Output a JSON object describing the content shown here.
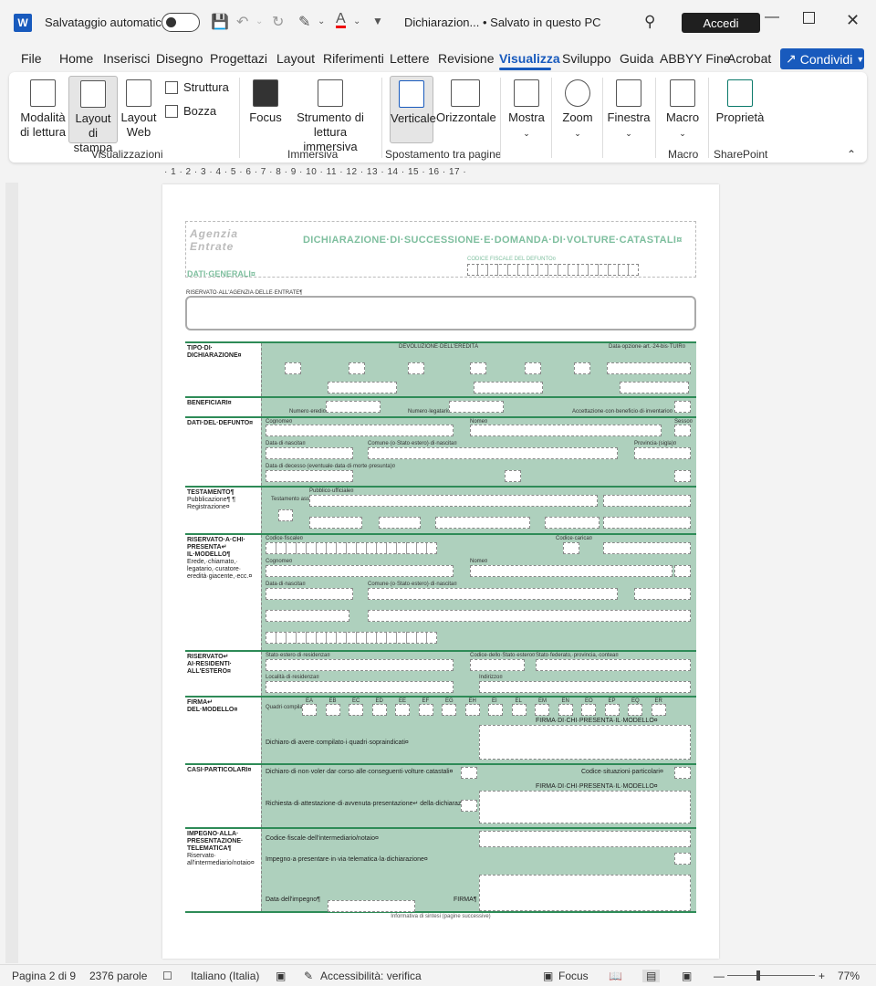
{
  "titlebar": {
    "app_icon": "W",
    "autosave_label": "Salvataggio automatico",
    "document_title": "Dichiarazion... • Salvato in questo PC",
    "signin_label": "Accedi",
    "icons": [
      "save-icon",
      "undo-icon",
      "redo-icon",
      "highlighter-icon",
      "font-color-icon",
      "customize-icon",
      "search-icon",
      "minimize-icon",
      "maximize-icon",
      "close-icon"
    ]
  },
  "menu": {
    "tabs": [
      "File",
      "Home",
      "Inserisci",
      "Disegno",
      "Progettazio",
      "Layout",
      "Riferimenti",
      "Lettere",
      "Revisione",
      "Visualizza",
      "Sviluppo",
      "Guida",
      "ABBYY Fine",
      "Acrobat"
    ],
    "active_tab": "Visualizza",
    "share_label": "Condividi",
    "accent": "#185abd"
  },
  "ribbon": {
    "views": {
      "reading_mode": "Modalità di lettura",
      "print_layout": "Layout di stampa",
      "web_layout": "Layout Web",
      "outline": "Struttura",
      "draft": "Bozza",
      "group_label": "Visualizzazioni"
    },
    "immersive": {
      "focus": "Focus",
      "immersive_reader": "Strumento di lettura immersiva",
      "group_label": "Immersiva"
    },
    "page_movement": {
      "vertical": "Verticale",
      "side_to_side": "Orizzontale",
      "group_label": "Spostamento tra pagine"
    },
    "show": "Mostra",
    "zoom": "Zoom",
    "window": "Finestra",
    "macros": {
      "macro": "Macro",
      "group_label": "Macro"
    },
    "sharepoint": {
      "properties": "Proprietà",
      "group_label": "SharePoint"
    }
  },
  "ruler": {
    "numbers": "· 1 · 2 · 3 · 4 · 5 · 6 · 7 · 8 · 9 · 10 · 11 · 12 · 13 · 14 · 15 · 16 · 17 ·"
  },
  "document": {
    "logo": "Agenzia Entrate",
    "heading": "DICHIARAZIONE·DI·SUCCESSIONE·E·DOMANDA·DI·VOLTURE·CATASTALI¤",
    "cf_label": "CODICE FISCALE DEL DEFUNTO¤",
    "dati_generali": "DATI·GENERALI¤",
    "reserved_label": "RISERVATO·ALL'AGENZIA·DELLE·ENTRATE¶",
    "sections": [
      {
        "title": "TIPO·DI· DICHIARAZIONE¤",
        "sub": ""
      },
      {
        "title": "BENEFICIARI¤",
        "sub": ""
      },
      {
        "title": "DATI·DEL·DEFUNTO¤",
        "sub": ""
      },
      {
        "title": "TESTAMENTO¶",
        "sub": "Pubblicazione¶ ¶ Registrazione¤"
      },
      {
        "title": "RISERVATO·A·CHI· PRESENTA↵ IL·MODELLO¶",
        "sub": "Erede,·chiamato,· legatario,·curatore· eredità·giacente,·ecc.¤"
      },
      {
        "title": "RISERVATO↵ AI·RESIDENTI· ALL'ESTERO¤",
        "sub": ""
      },
      {
        "title": "FIRMA↵ DEL·MODELLO¤",
        "sub": ""
      },
      {
        "title": "CASI·PARTICOLARI¤",
        "sub": ""
      },
      {
        "title": "IMPEGNO·ALLA· PRESENTAZIONE· TELEMATICA¶",
        "sub": "Riservato· all'intermediario/notaio¤"
      }
    ],
    "texts": {
      "devoluzione": "DEVOLUZIONE·DELL'EREDITÀ",
      "data_opzione": "Data·opzione·art.·24-bis·TUIR¤",
      "numero_eredi": "Numero·eredi¤",
      "numero_legatari": "Numero·legatari¤",
      "accettazione": "Accettazione·con·beneficio·di·inventario¤",
      "cognome": "Cognome¤",
      "nome": "Nome¤",
      "sesso": "Sesso¤",
      "data_nascita": "Data·di·nascita¤",
      "comune_nascita": "Comune·(o·Stato·estero)·di·nascita¤",
      "provincia": "Provincia·(sigla)¤",
      "data_morte": "Data·di·decesso·(eventuale·data·di·morte·presunta)¤",
      "testamento_assente": "Testamento assente¤",
      "pubblico_ufficiale": "Pubblico·ufficiale¤",
      "codice_fiscale": "Codice·fiscale¤",
      "codice_carica": "Codice·carica¤",
      "stato_estero": "Stato·estero·di·residenza¤",
      "codice_stato": "Codice·dello·Stato·estero¤",
      "stato_federato": "Stato·federato,·provincia,·contea¤",
      "localita": "Località·di·residenza¤",
      "indirizzo": "Indirizzo¤",
      "quadri": "Quadri·compilati¤",
      "dichiaro_compilato": "Dichiaro·di·avere·compilato·i·quadri·sopraindicati¤",
      "firma_chi_presenta": "FIRMA·DI·CHI·PRESENTA·IL·MODELLO¤",
      "dichiaro_non_volere": "Dichiaro·di·non·voler·dar·corso·alle·conseguenti·volture·catastali¤",
      "codice_situazioni": "Codice·situazioni·particolari¤",
      "richiesta_attestazione": "Richiesta·di·attestazione·di·avvenuta·presentazione↵ della·dichiarazione¤",
      "codice_fiscale_intermediario": "Codice·fiscale·dell'intermediario/notaio¤",
      "impegno_presentare": "Impegno·a·presentare·in·via·telematica·la·dichiarazione¤",
      "data_impegno": "Data·dell'impegno¶",
      "firma": "FIRMA¶",
      "footer_note": "Informativa di sintesi (pagine successive)",
      "pilcrow": "¶",
      "quadri_letters": [
        "EA",
        "EB",
        "EC",
        "ED",
        "EE",
        "EF",
        "EG",
        "EH",
        "EI",
        "EL",
        "EM",
        "EN",
        "EO",
        "EP",
        "EQ",
        "ER"
      ]
    }
  },
  "statusbar": {
    "page": "Pagina 2 di 9",
    "words": "2376 parole",
    "language": "Italiano (Italia)",
    "accessibility": "Accessibilità: verifica",
    "focus": "Focus",
    "zoom": "77%"
  }
}
